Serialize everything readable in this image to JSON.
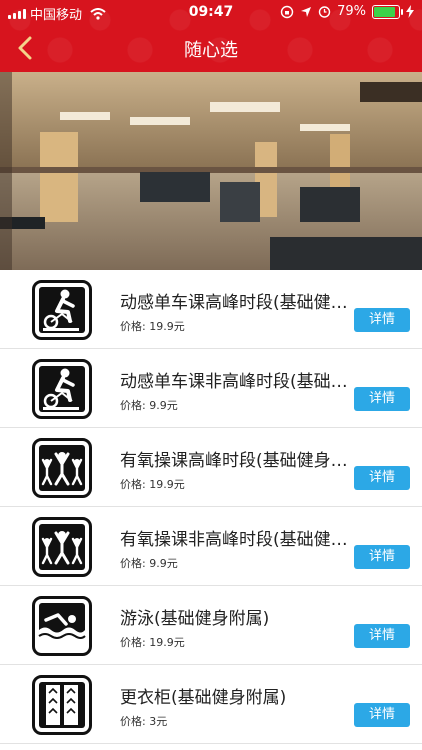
{
  "status": {
    "carrier": "中国移动",
    "time": "09:47",
    "battery": "79%"
  },
  "nav": {
    "title": "随心选"
  },
  "items": [
    {
      "name": "动感单车课高峰时段(基础健身附属)",
      "price_label": "价格:",
      "price": "19.9元",
      "button": "详情",
      "icon": "spin-bike-icon"
    },
    {
      "name": "动感单车课非高峰时段(基础健身附属)",
      "price_label": "价格:",
      "price": "9.9元",
      "button": "详情",
      "icon": "spin-bike-icon"
    },
    {
      "name": "有氧操课高峰时段(基础健身附属)",
      "price_label": "价格:",
      "price": "19.9元",
      "button": "详情",
      "icon": "aerobics-icon"
    },
    {
      "name": "有氧操课非高峰时段(基础健身附属)",
      "price_label": "价格:",
      "price": "9.9元",
      "button": "详情",
      "icon": "aerobics-icon"
    },
    {
      "name": "游泳(基础健身附属)",
      "price_label": "价格:",
      "price": "19.9元",
      "button": "详情",
      "icon": "swimming-icon"
    },
    {
      "name": "更衣柜(基础健身附属)",
      "price_label": "价格:",
      "price": "3元",
      "button": "详情",
      "icon": "locker-icon"
    }
  ]
}
